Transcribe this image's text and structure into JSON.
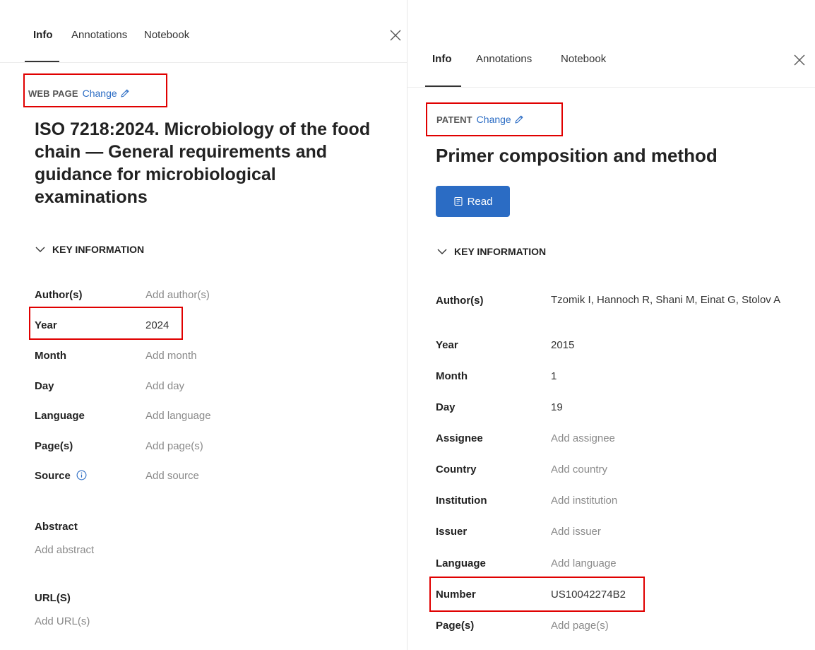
{
  "tabs": [
    "Info",
    "Annotations",
    "Notebook"
  ],
  "left": {
    "item_type": "WEB PAGE",
    "change_label": "Change",
    "title": "ISO 7218:2024. Microbiology of the food chain — General requirements and guidance for microbiological examinations",
    "section": "KEY INFORMATION",
    "fields": [
      {
        "label": "Author(s)",
        "value": "Add author(s)",
        "placeholder": true
      },
      {
        "label": "Year",
        "value": "2024",
        "placeholder": false
      },
      {
        "label": "Month",
        "value": "Add month",
        "placeholder": true
      },
      {
        "label": "Day",
        "value": "Add day",
        "placeholder": true
      },
      {
        "label": "Language",
        "value": "Add language",
        "placeholder": true
      },
      {
        "label": "Page(s)",
        "value": "Add page(s)",
        "placeholder": true
      },
      {
        "label": "Source",
        "value": "Add source",
        "placeholder": true
      }
    ],
    "abstract_label": "Abstract",
    "abstract_value": "Add abstract",
    "urls_label": "URL(S)",
    "urls_value": "Add URL(s)"
  },
  "right": {
    "item_type": "PATENT",
    "change_label": "Change",
    "title": "Primer composition and method",
    "read_label": "Read",
    "section": "KEY INFORMATION",
    "fields": [
      {
        "label": "Author(s)",
        "value": "Tzomik I, Hannoch R, Shani M, Einat G, Stolov A",
        "placeholder": false
      },
      {
        "label": "Year",
        "value": "2015",
        "placeholder": false
      },
      {
        "label": "Month",
        "value": "1",
        "placeholder": false
      },
      {
        "label": "Day",
        "value": "19",
        "placeholder": false
      },
      {
        "label": "Assignee",
        "value": "Add assignee",
        "placeholder": true
      },
      {
        "label": "Country",
        "value": "Add country",
        "placeholder": true
      },
      {
        "label": "Institution",
        "value": "Add institution",
        "placeholder": true
      },
      {
        "label": "Issuer",
        "value": "Add issuer",
        "placeholder": true
      },
      {
        "label": "Language",
        "value": "Add language",
        "placeholder": true
      },
      {
        "label": "Number",
        "value": "US10042274B2",
        "placeholder": false
      },
      {
        "label": "Page(s)",
        "value": "Add page(s)",
        "placeholder": true
      }
    ]
  },
  "colors": {
    "accent": "#2b6cc4",
    "highlight": "#e00000",
    "placeholder_text": "#8a8a8a"
  },
  "icons": [
    "close-icon",
    "pencil-icon",
    "chevron-down-icon",
    "info-icon",
    "reader-icon"
  ]
}
